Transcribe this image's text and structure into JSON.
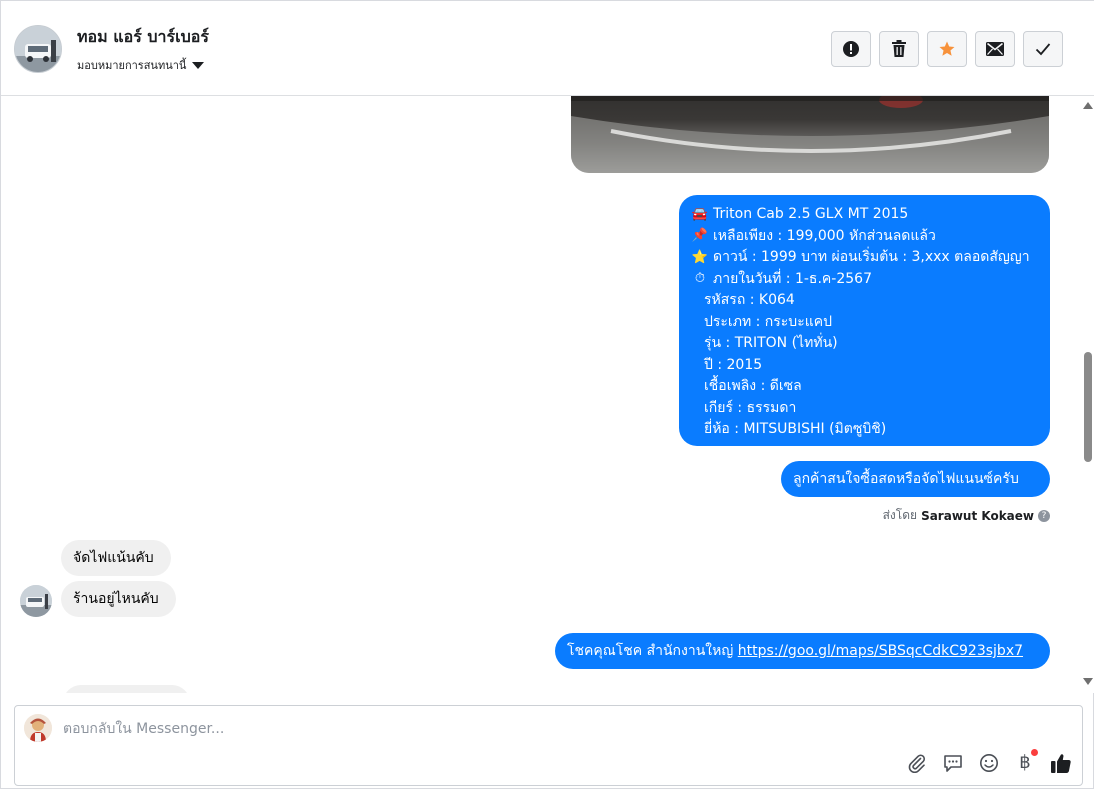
{
  "header": {
    "contact_name": "ทอม แอร์ บาร์เบอร์",
    "assign_label": "มอบหมายการสนทนานี้",
    "actions": [
      {
        "name": "mark-spam-button",
        "icon": "exclamation-circle-icon"
      },
      {
        "name": "delete-button",
        "icon": "trash-icon"
      },
      {
        "name": "star-button",
        "icon": "star-icon"
      },
      {
        "name": "mark-unread-button",
        "icon": "envelope-icon"
      },
      {
        "name": "mark-done-button",
        "icon": "checkmark-icon"
      }
    ]
  },
  "messages": {
    "car_listing": {
      "line1": "Triton Cab 2.5 GLX MT 2015",
      "line2": "เหลือเพียง : 199,000 หักส่วนลดแล้ว",
      "line3": "ดาวน์ : 1999 บาท ผ่อนเริ่มต้น : 3,xxx ตลอดสัญญา",
      "line4": "ภายในวันที่ : 1-ธ.ค-2567",
      "line5": "รหัสรถ : K064",
      "line6": "ประเภท : กระบะแคป",
      "line7": "รุ่น : TRITON (ไททั่น)",
      "line8": "ปี : 2015",
      "line9": "เชื้อเพลิง : ดีเซล",
      "line10": "เกียร์ : ธรรมดา",
      "line11": "ยี่ห้อ : MITSUBISHI (มิตซูบิชิ)"
    },
    "question": "ลูกค้าสนใจซื้อสดหรือจัดไฟแนนซ์ครับ",
    "sent_by_label": "ส่งโดย",
    "sent_by_name": "Sarawut Kokaew",
    "incoming1": "จัดไฟแน้นคับ",
    "incoming2": "ร้านอยู่ไหนคับ",
    "location_text": "โชคคุณโชค สำนักงานใหญ่",
    "location_link": "https://goo.gl/maps/SBSqcCdkC923sjbx7"
  },
  "composer": {
    "placeholder": "ตอบกลับใน Messenger..."
  },
  "colors": {
    "outgoing_bubble": "#0a7cff",
    "incoming_bubble": "#f0f0f0",
    "star_accent": "#f7923b"
  }
}
